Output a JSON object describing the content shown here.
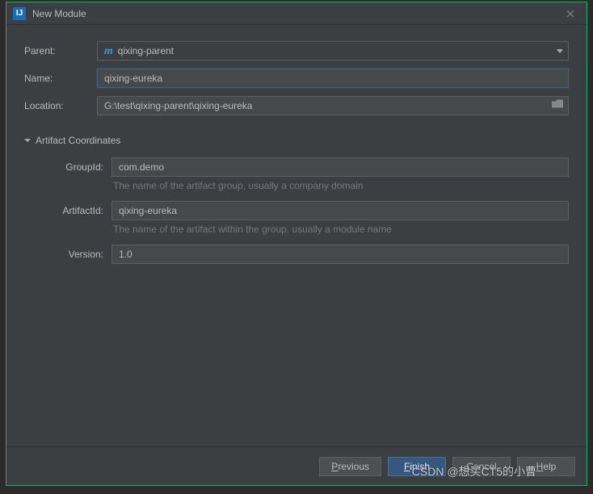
{
  "window": {
    "title": "New Module"
  },
  "fields": {
    "parent_label": "Parent:",
    "parent_value": "qixing-parent",
    "name_label": "Name:",
    "name_value": "qixing-eureka",
    "location_label": "Location:",
    "location_value": "G:\\test\\qixing-parent\\qixing-eureka"
  },
  "artifact": {
    "section_title": "Artifact Coordinates",
    "group_label": "GroupId:",
    "group_value": "com.demo",
    "group_hint": "The name of the artifact group, usually a company domain",
    "artifact_label": "ArtifactId:",
    "artifact_value": "qixing-eureka",
    "artifact_hint": "The name of the artifact within the group, usually a module name",
    "version_label": "Version:",
    "version_value": "1.0"
  },
  "buttons": {
    "previous": "Previous",
    "finish": "Finish",
    "cancel": "Cancel",
    "help": "Help"
  },
  "watermark": "CSDN @想买CT5的小曹"
}
